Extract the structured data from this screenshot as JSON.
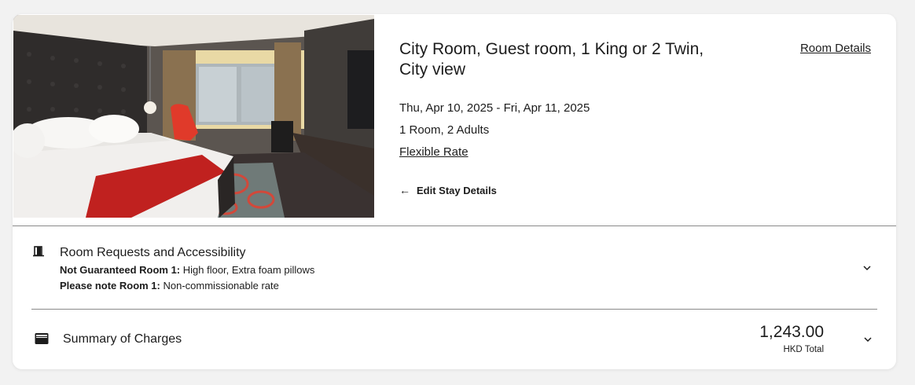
{
  "room": {
    "title": "City Room, Guest room, 1 King or 2 Twin, City view",
    "details_link": "Room Details",
    "dates": "Thu, Apr 10, 2025 - Fri, Apr 11, 2025",
    "occupancy": "1 Room, 2 Adults",
    "rate_link": "Flexible Rate",
    "edit_label": "Edit Stay Details",
    "edit_icon": "arrow-left-icon"
  },
  "requests": {
    "icon": "door-icon",
    "title": "Room Requests and Accessibility",
    "line1_label": "Not Guaranteed Room 1:",
    "line1_value": " High floor, Extra foam pillows",
    "line2_label": "Please note Room 1:",
    "line2_value": " Non-commissionable rate",
    "toggle_icon": "chevron-down-icon"
  },
  "charges": {
    "icon": "wallet-icon",
    "title": "Summary of Charges",
    "amount": "1,243.00",
    "amount_label": "HKD Total",
    "toggle_icon": "chevron-down-icon"
  },
  "colors": {
    "card_bg": "#ffffff",
    "page_bg": "#f2f2f2",
    "text": "#1c1c1c",
    "divider": "#8a8a8a",
    "bed_runner": "#c0211f"
  }
}
